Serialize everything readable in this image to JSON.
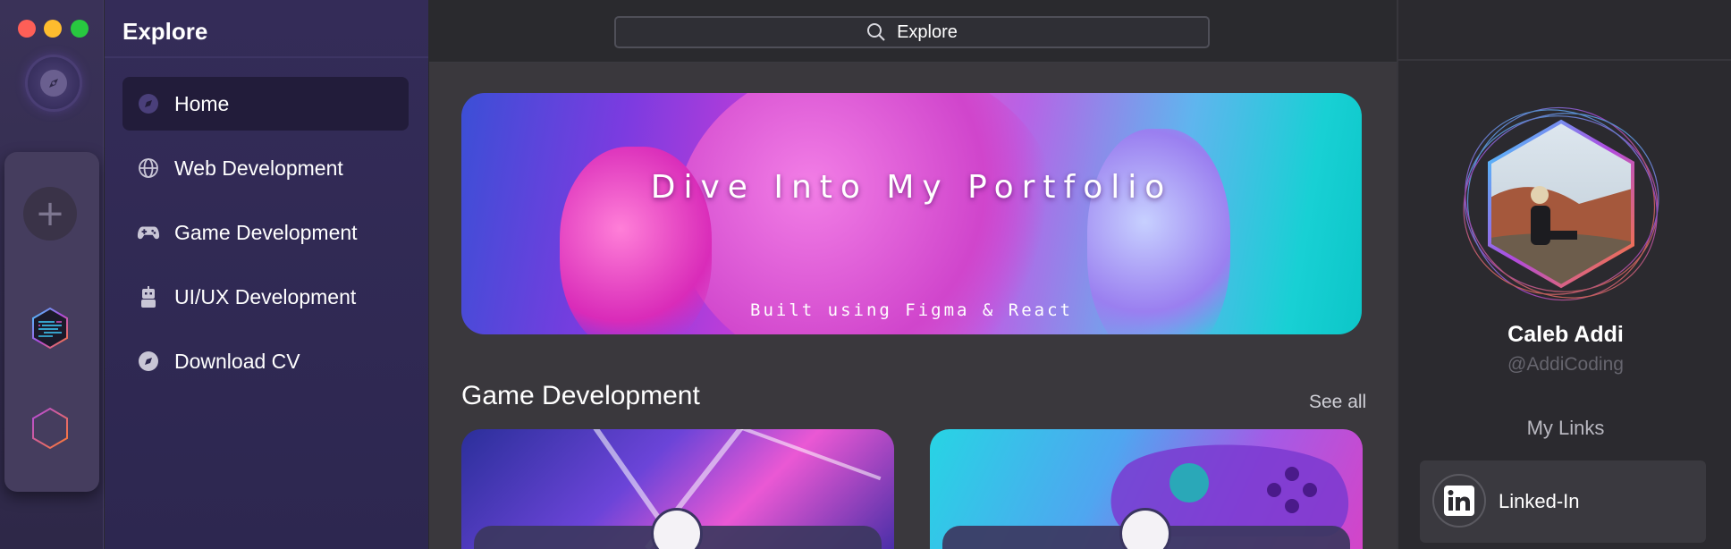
{
  "window": {
    "controls": [
      "close",
      "minimize",
      "maximize"
    ]
  },
  "rail": {
    "items": [
      {
        "icon": "compass-icon"
      },
      {
        "icon": "plus-icon"
      },
      {
        "icon": "code-hexagon-icon"
      },
      {
        "icon": "hexagon-icon"
      }
    ]
  },
  "sidebar": {
    "title": "Explore",
    "items": [
      {
        "label": "Home",
        "icon": "compass-icon",
        "active": true
      },
      {
        "label": "Web Development",
        "icon": "globe-icon",
        "active": false
      },
      {
        "label": "Game Development",
        "icon": "gamepad-icon",
        "active": false
      },
      {
        "label": "UI/UX Development",
        "icon": "robot-icon",
        "active": false
      },
      {
        "label": "Download CV",
        "icon": "compass-icon",
        "active": false
      }
    ]
  },
  "search": {
    "value": "Explore"
  },
  "hero": {
    "title": "Dive Into My Portfolio",
    "subtitle": "Built using Figma & React"
  },
  "section": {
    "title": "Game Development",
    "see_all": "See all"
  },
  "profile": {
    "name": "Caleb Addi",
    "handle": "@AddiCoding",
    "links_title": "My Links",
    "links": [
      {
        "label": "Linked-In",
        "icon": "linkedin-icon"
      }
    ]
  },
  "colors": {
    "accent": "#7c3be0",
    "active_nav": "#221c3a",
    "close": "#fe5f57",
    "minimize": "#febc2e",
    "maximize": "#28c840"
  }
}
